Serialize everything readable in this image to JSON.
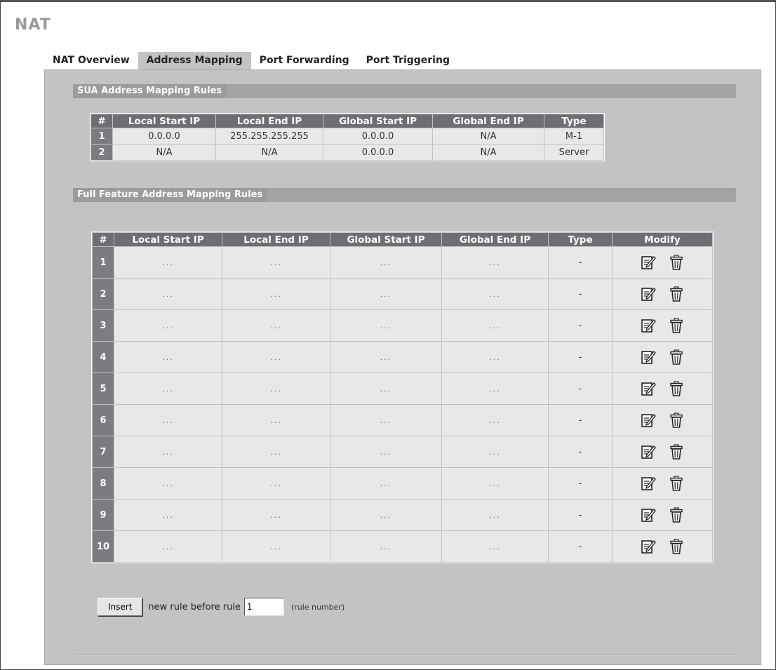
{
  "page": {
    "title": "NAT"
  },
  "tabs": [
    {
      "label": "NAT Overview",
      "active": false
    },
    {
      "label": "Address Mapping",
      "active": true
    },
    {
      "label": "Port Forwarding",
      "active": false
    },
    {
      "label": "Port Triggering",
      "active": false
    }
  ],
  "sua": {
    "title": "SUA Address Mapping Rules",
    "headers": [
      "#",
      "Local Start IP",
      "Local End IP",
      "Global Start IP",
      "Global End IP",
      "Type"
    ],
    "rows": [
      [
        "1",
        "0.0.0.0",
        "255.255.255.255",
        "0.0.0.0",
        "N/A",
        "M-1"
      ],
      [
        "2",
        "N/A",
        "N/A",
        "0.0.0.0",
        "N/A",
        "Server"
      ]
    ]
  },
  "full": {
    "title": "Full Feature Address Mapping Rules",
    "headers": [
      "#",
      "Local Start IP",
      "Local End IP",
      "Global Start IP",
      "Global End IP",
      "Type",
      "Modify"
    ],
    "rows": [
      [
        "1",
        "...",
        "...",
        "...",
        "...",
        "-"
      ],
      [
        "2",
        "...",
        "...",
        "...",
        "...",
        "-"
      ],
      [
        "3",
        "...",
        "...",
        "...",
        "...",
        "-"
      ],
      [
        "4",
        "...",
        "...",
        "...",
        "...",
        "-"
      ],
      [
        "5",
        "...",
        "...",
        "...",
        "...",
        "-"
      ],
      [
        "6",
        "...",
        "...",
        "...",
        "...",
        "-"
      ],
      [
        "7",
        "...",
        "...",
        "...",
        "...",
        "-"
      ],
      [
        "8",
        "...",
        "...",
        "...",
        "...",
        "-"
      ],
      [
        "9",
        "...",
        "...",
        "...",
        "...",
        "-"
      ],
      [
        "10",
        "...",
        "...",
        "...",
        "...",
        "-"
      ]
    ],
    "modify_icons": [
      "edit-icon",
      "trash-icon"
    ]
  },
  "insert": {
    "button_label": "Insert",
    "text": "new rule before rule",
    "value": "1",
    "hint": "(rule number)"
  }
}
